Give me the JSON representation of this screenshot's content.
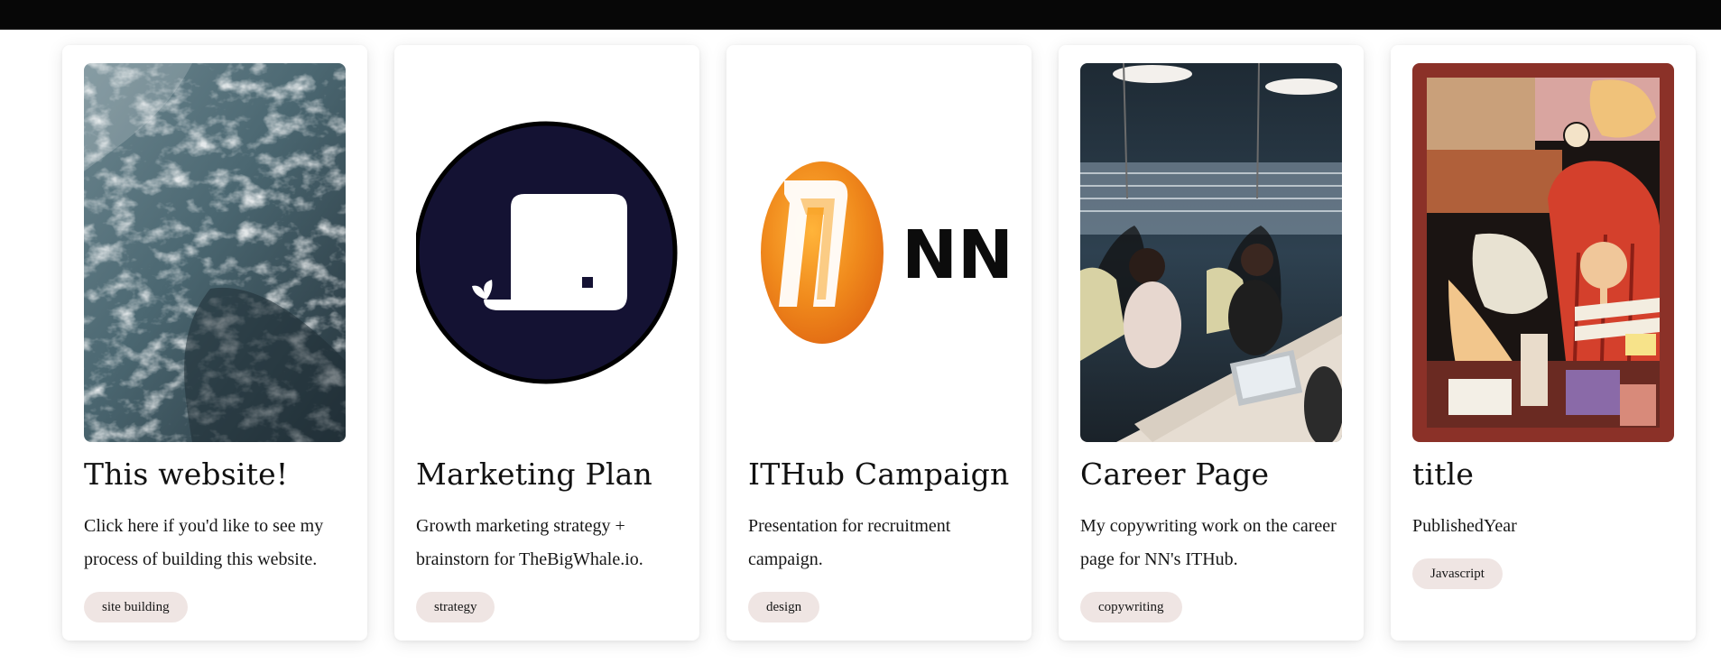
{
  "projects": [
    {
      "title": "This website!",
      "description": "Click here if you'd like to see my process of building this website.",
      "tag": "site building",
      "image": "ocean-waves-photo"
    },
    {
      "title": "Marketing Plan",
      "description": "Growth marketing strategy + brainstorn for TheBigWhale.io.",
      "tag": "strategy",
      "image": "thebigwhale-logo"
    },
    {
      "title": "ITHub Campaign",
      "description": "Presentation for recruitment campaign.",
      "tag": "design",
      "image": "nn-logo",
      "logo_text": "NN"
    },
    {
      "title": "Career Page",
      "description": "My copywriting work on the career page for NN's ITHub.",
      "tag": "copywriting",
      "image": "office-meeting-photo"
    },
    {
      "title": "title",
      "description": "PublishedYear",
      "tag": "Javascript",
      "image": "collage-illustration"
    }
  ],
  "colors": {
    "topbar": "#070707",
    "tag_background": "#efe5e3",
    "whale_circle": "#141233",
    "nn_orange": "#f08a1c",
    "collage_frame": "#8b3128"
  }
}
